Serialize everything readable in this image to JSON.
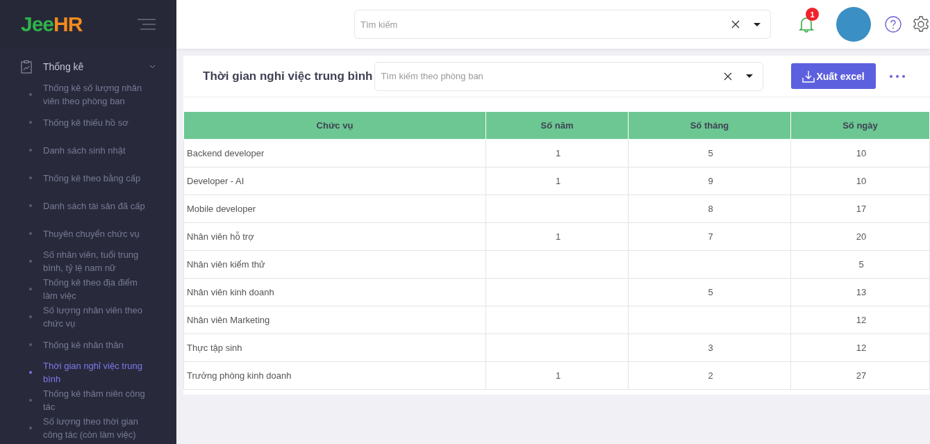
{
  "logo": {
    "first": "Jee",
    "second": "HR"
  },
  "sidebar": {
    "group": {
      "label": "Thống kê",
      "expanded": true
    },
    "items": [
      {
        "label": "Thống kê số lượng nhân viên theo phòng ban",
        "selected": false
      },
      {
        "label": "Thống kê thiếu hồ sơ",
        "selected": false
      },
      {
        "label": "Danh sách sinh nhật",
        "selected": false
      },
      {
        "label": "Thống kê theo bằng cấp",
        "selected": false
      },
      {
        "label": "Danh sách tài sản đã cấp",
        "selected": false
      },
      {
        "label": "Thuyên chuyển chức vụ",
        "selected": false
      },
      {
        "label": "Số nhân viên, tuổi trung bình, tỷ lệ nam nữ",
        "selected": false
      },
      {
        "label": "Thống kê theo địa điểm làm việc",
        "selected": false
      },
      {
        "label": "Số lượng nhân viên theo chức vụ",
        "selected": false
      },
      {
        "label": "Thống kê nhân thân",
        "selected": false
      },
      {
        "label": "Thời gian nghỉ việc trung bình",
        "selected": true
      },
      {
        "label": "Thống kê thâm niên công tác",
        "selected": false
      },
      {
        "label": "Số lượng theo thời gian công tác (còn làm việc)",
        "selected": false
      }
    ]
  },
  "header": {
    "search": {
      "placeholder": "Tìm kiếm"
    },
    "notifications": "1"
  },
  "card": {
    "title": "Thời gian nghỉ việc trung bình",
    "filter": {
      "placeholder": "Tìm kiếm theo phòng ban"
    },
    "export_button": "Xuất excel"
  },
  "table": {
    "columns": [
      "Chức vụ",
      "Số năm",
      "Số tháng",
      "Số ngày"
    ],
    "rows": [
      [
        "Backend developer",
        "1",
        "5",
        "10"
      ],
      [
        "Developer - AI",
        "1",
        "9",
        "10"
      ],
      [
        "Mobile developer",
        "",
        "8",
        "17"
      ],
      [
        "Nhân viên hỗ trợ",
        "1",
        "7",
        "20"
      ],
      [
        "Nhân viên kiểm thử",
        "",
        "",
        "5"
      ],
      [
        "Nhân viên kinh doanh",
        "",
        "5",
        "13"
      ],
      [
        "Nhân viên Marketing",
        "",
        "",
        "12"
      ],
      [
        "Thực tập sinh",
        "",
        "3",
        "12"
      ],
      [
        "Trưởng phòng kinh doanh",
        "1",
        "2",
        "27"
      ]
    ]
  }
}
